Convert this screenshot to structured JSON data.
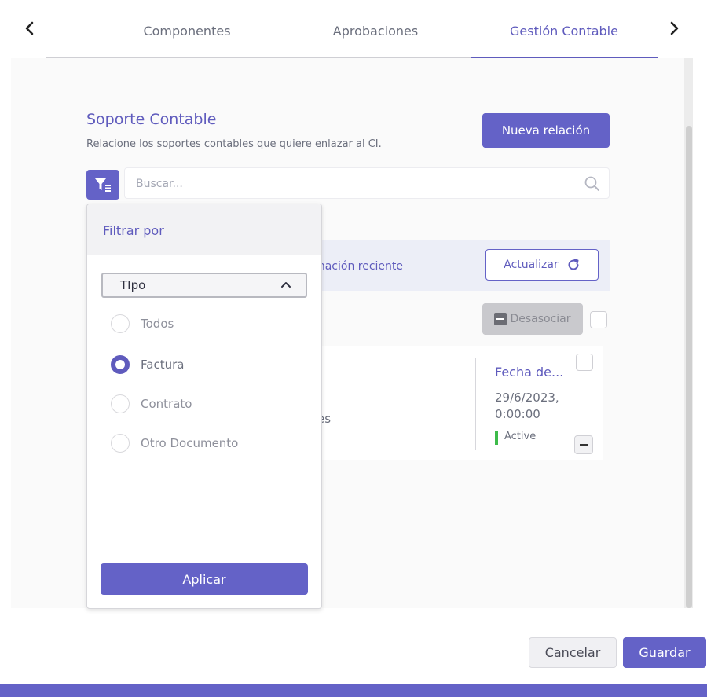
{
  "tabs": {
    "items": [
      {
        "label": "Componentes"
      },
      {
        "label": "Aprobaciones"
      },
      {
        "label": "Gestión Contable"
      }
    ],
    "active": "Gestión Contable"
  },
  "section": {
    "title": "Soporte Contable",
    "subtitle": "Relacione los soportes contables que quiere enlazar al CI.",
    "new_button": "Nueva relación"
  },
  "search": {
    "placeholder": "Buscar..."
  },
  "info_bar": {
    "partial_text": "ormación reciente",
    "update_button": "Actualizar"
  },
  "toolbar": {
    "disassociate_label": "Desasociar"
  },
  "card": {
    "partial_text": "es",
    "field_label": "Fecha de...",
    "date": "29/6/2023,",
    "time": "0:00:00",
    "status": "Active",
    "status_color": "#3dbb4a"
  },
  "filter": {
    "title": "Filtrar por",
    "select_label": "TIpo",
    "options": [
      {
        "label": "Todos",
        "checked": false
      },
      {
        "label": "Factura",
        "checked": true
      },
      {
        "label": "Contrato",
        "checked": false
      },
      {
        "label": "Otro Documento",
        "checked": false
      }
    ],
    "apply_label": "Aplicar"
  },
  "footer": {
    "cancel_label": "Cancelar",
    "save_label": "Guardar"
  },
  "colors": {
    "accent": "#6462c7",
    "text": "#6b6f7d"
  }
}
